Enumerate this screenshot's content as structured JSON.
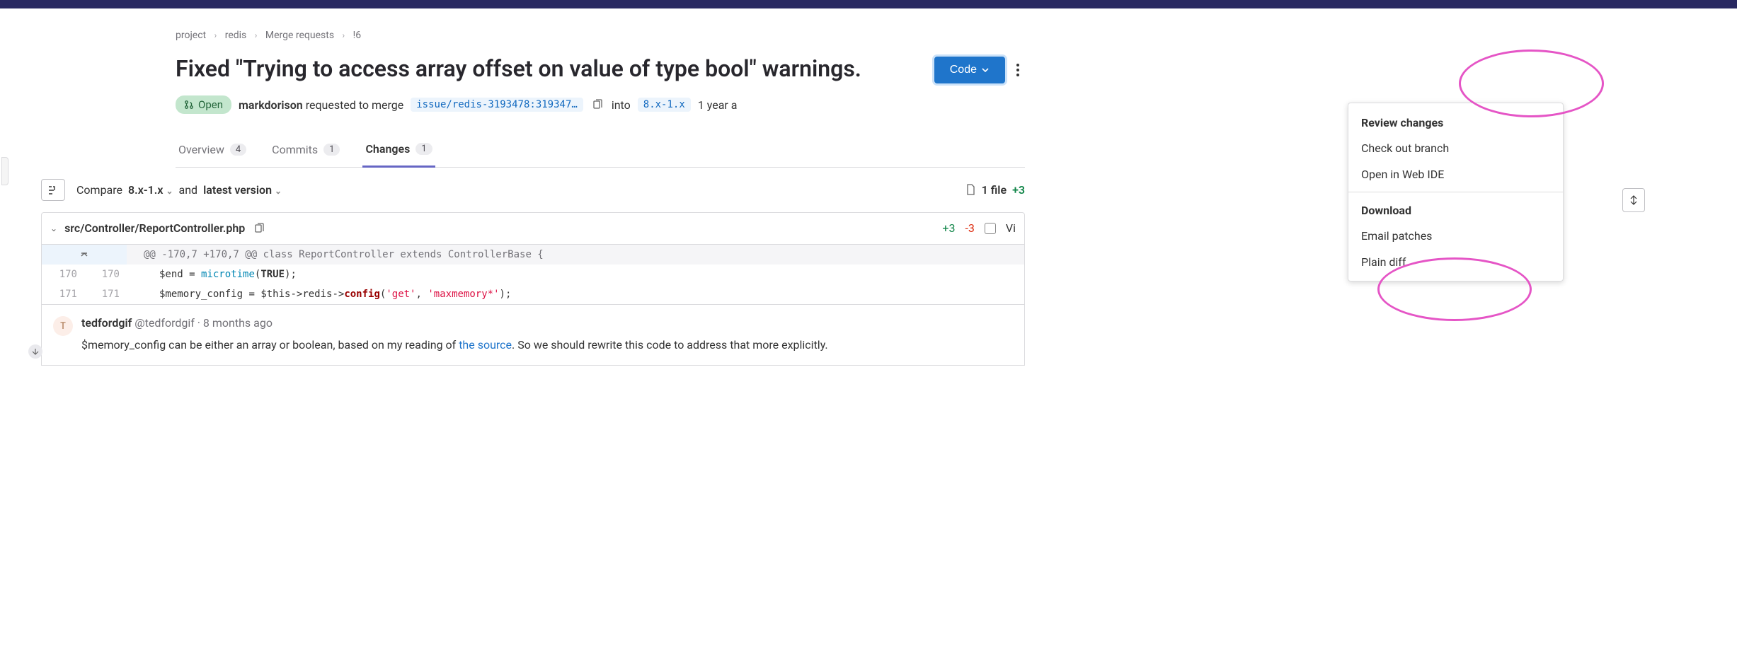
{
  "breadcrumbs": {
    "p1": "project",
    "p2": "redis",
    "p3": "Merge requests",
    "p4": "!6"
  },
  "mr": {
    "title": "Fixed \"Trying to access array offset on value of type bool\" warnings.",
    "status": "Open",
    "author": "markdorison",
    "requested_text": " requested to merge ",
    "source_branch": "issue/redis-3193478:319347…",
    "into_text": " into ",
    "target_branch": "8.x-1.x",
    "time_ago": "1 year a"
  },
  "code_button_label": "Code",
  "tabs": {
    "overview": {
      "label": "Overview",
      "count": "4"
    },
    "commits": {
      "label": "Commits",
      "count": "1"
    },
    "changes": {
      "label": "Changes",
      "count": "1"
    }
  },
  "dropdown": {
    "review_title": "Review changes",
    "checkout": "Check out branch",
    "webide": "Open in Web IDE",
    "download_title": "Download",
    "email": "Email patches",
    "plain": "Plain diff"
  },
  "compare": {
    "label": "Compare",
    "base": "8.x-1.x",
    "and": "and",
    "latest": "latest version",
    "file_summary": "1 file",
    "summary_add": "+3"
  },
  "file": {
    "path": "src/Controller/ReportController.php",
    "additions": "+3",
    "deletions": "-3",
    "viewed_label": "Vi"
  },
  "hunk": "@@ -170,7 +170,7 @@ class ReportController extends ControllerBase {",
  "lines": {
    "l170_old": "170",
    "l170_new": "170",
    "l171_old": "171",
    "l171_new": "171"
  },
  "comment": {
    "avatar_initial": "T",
    "author": "tedfordgif",
    "handle": "@tedfordgif",
    "time": "8 months ago",
    "body_pre": "$memory_config can be either an array or boolean, based on my reading of ",
    "body_link": "the source",
    "body_post": ". So we should rewrite this code to address that more explicitly."
  }
}
